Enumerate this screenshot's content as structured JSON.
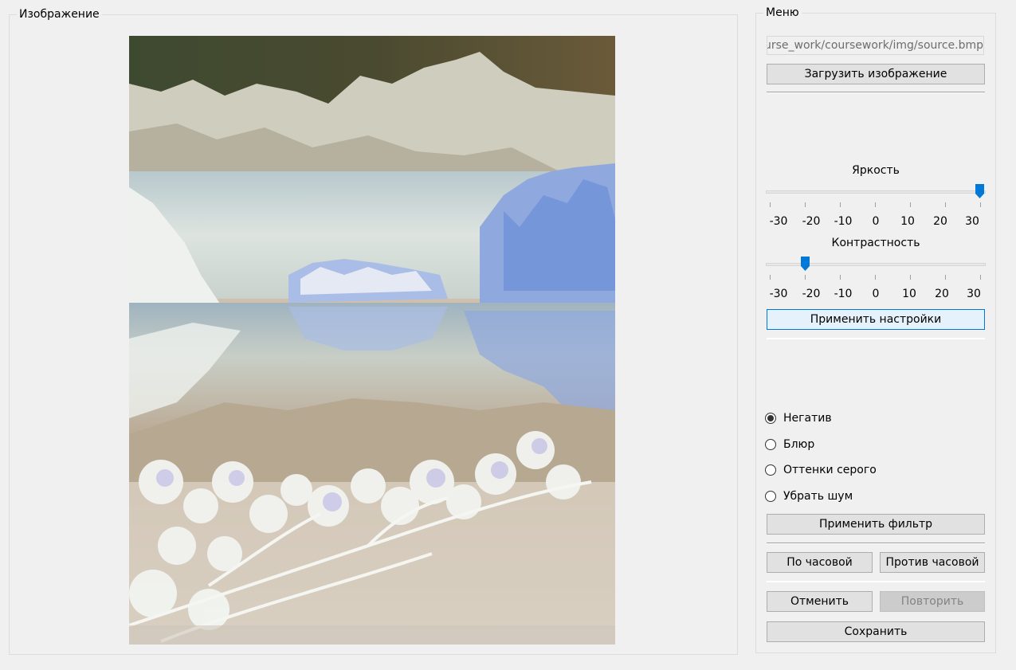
{
  "image_panel": {
    "title": "Изображение"
  },
  "menu": {
    "title": "Меню",
    "path_value": "ourse_work/coursework/img/source.bmp",
    "load_button": "Загрузить изображение",
    "brightness": {
      "label": "Яркость",
      "value": 30,
      "min": -30,
      "max": 30,
      "ticks": [
        "-30",
        "-20",
        "-10",
        "0",
        "10",
        "20",
        "30"
      ]
    },
    "contrast": {
      "label": "Контрастность",
      "value": -20,
      "min": -30,
      "max": 30,
      "ticks": [
        "-30",
        "-20",
        "-10",
        "0",
        "10",
        "20",
        "30"
      ]
    },
    "apply_settings_button": "Применить настройки",
    "filters": [
      {
        "label": "Негатив",
        "checked": true
      },
      {
        "label": "Блюр",
        "checked": false
      },
      {
        "label": "Оттенки серого",
        "checked": false
      },
      {
        "label": "Убрать шум",
        "checked": false
      }
    ],
    "apply_filter_button": "Применить фильтр",
    "rotate_cw_button": "По часовой",
    "rotate_ccw_button": "Против часовой",
    "undo_button": "Отменить",
    "redo_button": "Повторить",
    "save_button": "Сохранить"
  },
  "colors": {
    "accent": "#0078d7",
    "window_bg": "#f0f0f0",
    "button_bg": "#e1e1e1"
  }
}
